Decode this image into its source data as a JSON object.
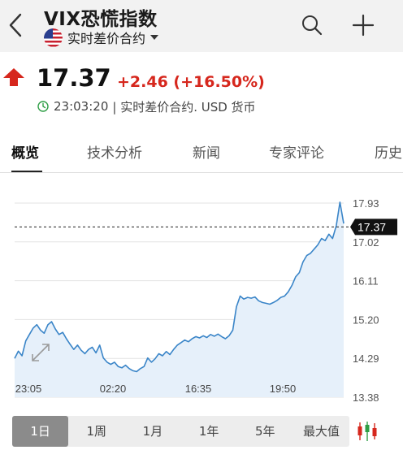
{
  "header": {
    "title": "VIX恐慌指数",
    "instrument_type": "实时差价合约"
  },
  "quote": {
    "price": "17.37",
    "change": "+2.46 (+16.50%)",
    "timestamp": "23:03:20",
    "meta_suffix": "| 实时差价合约.  USD 货币",
    "direction": "up",
    "colors": {
      "up": "#d6271d",
      "line": "#3a85c8",
      "fill": "#e6f0fa"
    }
  },
  "tabs": [
    {
      "label": "概览",
      "active": true
    },
    {
      "label": "技术分析",
      "active": false
    },
    {
      "label": "新闻",
      "active": false
    },
    {
      "label": "专家评论",
      "active": false
    },
    {
      "label": "历史",
      "active": false
    }
  ],
  "chart_data": {
    "type": "area",
    "y_ticks": [
      "17.93",
      "17.02",
      "16.11",
      "15.20",
      "14.29",
      "13.38"
    ],
    "x_ticks": [
      "23:05",
      "02:20",
      "16:35",
      "19:50"
    ],
    "ylim": [
      13.38,
      17.93
    ],
    "last_price_label": "17.37",
    "last_price": 17.37,
    "values": [
      14.29,
      14.46,
      14.35,
      14.7,
      14.85,
      15.0,
      15.08,
      14.95,
      14.88,
      15.08,
      15.15,
      14.98,
      14.85,
      14.9,
      14.75,
      14.62,
      14.5,
      14.6,
      14.48,
      14.4,
      14.5,
      14.55,
      14.42,
      14.6,
      14.3,
      14.2,
      14.15,
      14.2,
      14.1,
      14.07,
      14.13,
      14.05,
      14.0,
      13.98,
      14.05,
      14.1,
      14.3,
      14.2,
      14.28,
      14.4,
      14.35,
      14.45,
      14.38,
      14.5,
      14.6,
      14.66,
      14.72,
      14.68,
      14.75,
      14.8,
      14.77,
      14.82,
      14.78,
      14.85,
      14.81,
      14.86,
      14.8,
      14.75,
      14.82,
      14.95,
      15.5,
      15.75,
      15.68,
      15.72,
      15.7,
      15.73,
      15.64,
      15.6,
      15.58,
      15.56,
      15.6,
      15.65,
      15.72,
      15.75,
      15.85,
      16.0,
      16.2,
      16.3,
      16.55,
      16.7,
      16.75,
      16.85,
      16.95,
      17.1,
      17.05,
      17.2,
      17.1,
      17.4,
      17.95,
      17.45
    ]
  },
  "ranges": [
    {
      "label": "1日",
      "active": true
    },
    {
      "label": "1周",
      "active": false
    },
    {
      "label": "1月",
      "active": false
    },
    {
      "label": "1年",
      "active": false
    },
    {
      "label": "5年",
      "active": false
    },
    {
      "label": "最大值",
      "active": false
    }
  ],
  "icons": {
    "back": "chevron-left-icon",
    "search": "search-icon",
    "add": "plus-icon",
    "flag": "us-flag-icon",
    "clock": "clock-icon",
    "expand": "expand-icon",
    "chart_type": "candlestick-icon"
  }
}
